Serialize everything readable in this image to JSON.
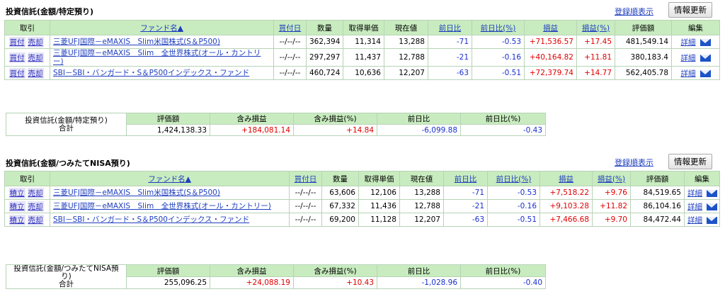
{
  "section1": {
    "title": "投資信託(金額/特定預り)",
    "order_link": "登録順表示",
    "refresh": "情報更新",
    "headers": [
      "取引",
      "ファンド名▲",
      "買付日",
      "数量",
      "取得単価",
      "現在値",
      "前日比",
      "前日比(%)",
      "損益",
      "損益(%)",
      "評価額",
      "編集"
    ],
    "rows": [
      {
        "buy": "買付",
        "sell": "売却",
        "fund": "三菱UFJ国際－eMAXIS　Slim米国株式(S＆P500)",
        "date": "--/--/--",
        "qty": "362,394",
        "cost": "11,314",
        "price": "13,288",
        "chg": "-71",
        "chg_pct": "-0.53",
        "pl": "+71,536.57",
        "pl_pct": "+17.45",
        "value": "481,549.14",
        "detail": "詳細"
      },
      {
        "buy": "買付",
        "sell": "売却",
        "fund": "三菱UFJ国際－eMAXIS　Slim　全世界株式(オール・カントリー)",
        "date": "--/--/--",
        "qty": "297,297",
        "cost": "11,437",
        "price": "12,788",
        "chg": "-21",
        "chg_pct": "-0.16",
        "pl": "+40,164.82",
        "pl_pct": "+11.81",
        "value": "380,183.4",
        "detail": "詳細"
      },
      {
        "buy": "買付",
        "sell": "売却",
        "fund": "SBI－SBI・バンガード・S＆P500インデックス・ファンド",
        "date": "--/--/--",
        "qty": "460,724",
        "cost": "10,636",
        "price": "12,207",
        "chg": "-63",
        "chg_pct": "-0.51",
        "pl": "+72,379.74",
        "pl_pct": "+14.77",
        "value": "562,405.78",
        "detail": "詳細"
      }
    ],
    "summary": {
      "label": "投資信託(金額/特定預り)",
      "total_label": "合計",
      "headers": [
        "評価額",
        "含み損益",
        "含み損益(%)",
        "前日比",
        "前日比(%)"
      ],
      "values": [
        "1,424,138.33",
        "+184,081.14",
        "+14.84",
        "-6,099.88",
        "-0.43"
      ]
    }
  },
  "section2": {
    "title": "投資信託(金額/つみたてNISA預り)",
    "order_link": "登録順表示",
    "refresh": "情報更新",
    "headers": [
      "取引",
      "ファンド名▲",
      "買付日",
      "数量",
      "取得単価",
      "現在値",
      "前日比",
      "前日比(%)",
      "損益",
      "損益(%)",
      "評価額",
      "編集"
    ],
    "rows": [
      {
        "buy": "積立",
        "sell": "売却",
        "fund": "三菱UFJ国際－eMAXIS　Slim米国株式(S＆P500)",
        "date": "--/--/--",
        "qty": "63,606",
        "cost": "12,106",
        "price": "13,288",
        "chg": "-71",
        "chg_pct": "-0.53",
        "pl": "+7,518.22",
        "pl_pct": "+9.76",
        "value": "84,519.65",
        "detail": "詳細"
      },
      {
        "buy": "積立",
        "sell": "売却",
        "fund": "三菱UFJ国際－eMAXIS　Slim　全世界株式(オール・カントリー)",
        "date": "--/--/--",
        "qty": "67,332",
        "cost": "11,436",
        "price": "12,788",
        "chg": "-21",
        "chg_pct": "-0.16",
        "pl": "+9,103.28",
        "pl_pct": "+11.82",
        "value": "86,104.16",
        "detail": "詳細"
      },
      {
        "buy": "積立",
        "sell": "売却",
        "fund": "SBI－SBI・バンガード・S＆P500インデックス・ファンド",
        "date": "--/--/--",
        "qty": "69,200",
        "cost": "11,128",
        "price": "12,207",
        "chg": "-63",
        "chg_pct": "-0.51",
        "pl": "+7,466.68",
        "pl_pct": "+9.70",
        "value": "84,472.44",
        "detail": "詳細"
      }
    ],
    "summary": {
      "label": "投資信託(金額/つみたてNISA預り)",
      "total_label": "合計",
      "headers": [
        "評価額",
        "含み損益",
        "含み損益(%)",
        "前日比",
        "前日比(%)"
      ],
      "values": [
        "255,096.25",
        "+24,088.19",
        "+10.43",
        "-1,028.96",
        "-0.40"
      ]
    }
  },
  "colors": {
    "header_bg": "#c8ecbf",
    "positive": "#e00000",
    "negative": "#1a2fd0",
    "link": "#1f3fbf"
  },
  "icons": {
    "mail": "mail-icon"
  }
}
